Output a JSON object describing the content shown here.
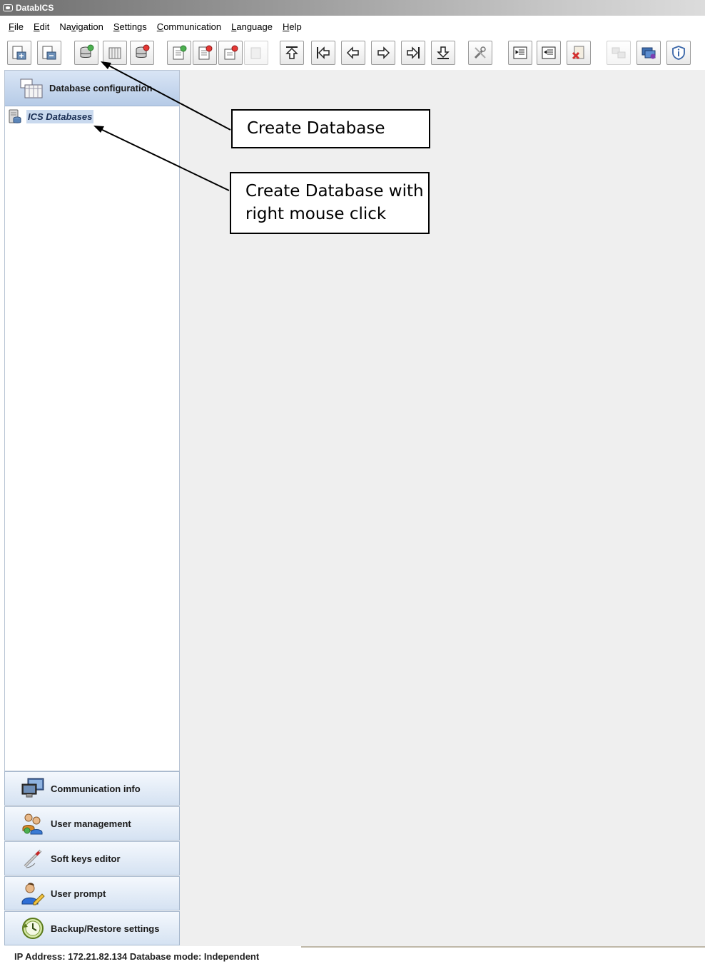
{
  "window": {
    "title": "DatabICS"
  },
  "menu": [
    {
      "label": "File",
      "mnemonic": "F",
      "rest": "ile"
    },
    {
      "label": "Edit",
      "mnemonic": "E",
      "rest": "dit"
    },
    {
      "label": "Navigation",
      "pre": "Na",
      "mnemonic": "v",
      "rest": "igation"
    },
    {
      "label": "Settings",
      "mnemonic": "S",
      "rest": "ettings"
    },
    {
      "label": "Communication",
      "mnemonic": "C",
      "rest": "ommunication"
    },
    {
      "label": "Language",
      "mnemonic": "L",
      "rest": "anguage"
    },
    {
      "label": "Help",
      "mnemonic": "H",
      "rest": "elp"
    }
  ],
  "toolbar": {
    "icons": [
      "import-icon",
      "export-icon",
      "create-database-icon",
      "edit-database-icon",
      "delete-database-icon",
      "new-record-icon",
      "delete-record-icon",
      "edit-record-icon",
      "copy-record-icon",
      "first-record-icon",
      "previous-page-icon",
      "previous-record-icon",
      "next-record-icon",
      "next-page-icon",
      "last-record-icon",
      "tools-icon",
      "indent-icon",
      "outdent-icon",
      "remove-file-icon",
      "network-icon",
      "monitor-icon",
      "info-shield-icon"
    ]
  },
  "sidebar": {
    "header": "Database configuration",
    "tree_root": "ICS Databases"
  },
  "nav_buttons": [
    {
      "label": "Communication info",
      "icon": "computer-network-icon"
    },
    {
      "label": "User management",
      "icon": "users-icon"
    },
    {
      "label": "Soft keys editor",
      "icon": "pen-icon"
    },
    {
      "label": "User prompt",
      "icon": "user-edit-icon"
    },
    {
      "label": "Backup/Restore settings",
      "icon": "clock-restore-icon"
    }
  ],
  "callouts": {
    "create_database": "Create Database",
    "create_database_right_click_line1": "Create Database with",
    "create_database_right_click_line2": "right mouse click"
  },
  "status": {
    "text": "IP Address: 172.21.82.134  Database mode: Independent"
  }
}
